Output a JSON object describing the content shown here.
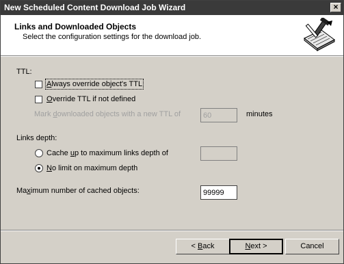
{
  "window": {
    "title": "New Scheduled Content Download Job Wizard",
    "close_glyph": "×"
  },
  "header": {
    "title": "Links and Downloaded Objects",
    "subtitle": "Select the configuration settings for the download job."
  },
  "ttl": {
    "group_label": "TTL:",
    "always_override": {
      "pre": "",
      "u": "A",
      "post": "lways override object's TTL",
      "checked": false
    },
    "override_if_not_defined": {
      "pre": "",
      "u": "O",
      "post": "verride TTL if not defined",
      "checked": false
    },
    "mark_label": {
      "pre": "Mark ",
      "u": "d",
      "post": "ownloaded objects with a new TTL of"
    },
    "ttl_value": "60",
    "units": "minutes"
  },
  "links_depth": {
    "group_label": "Links depth:",
    "cache_up_to": {
      "pre": "Cache ",
      "u": "u",
      "post": "p to maximum links depth of",
      "selected": false
    },
    "no_limit": {
      "pre": "",
      "u": "N",
      "post": "o limit on maximum depth",
      "selected": true
    },
    "depth_value": ""
  },
  "max_objects": {
    "label": {
      "pre": "Ma",
      "u": "x",
      "post": "imum number of cached objects:"
    },
    "value": "99999"
  },
  "buttons": {
    "back": {
      "pre": "< ",
      "u": "B",
      "post": "ack"
    },
    "next": {
      "pre": "",
      "u": "N",
      "post": "ext >"
    },
    "cancel": "Cancel"
  }
}
